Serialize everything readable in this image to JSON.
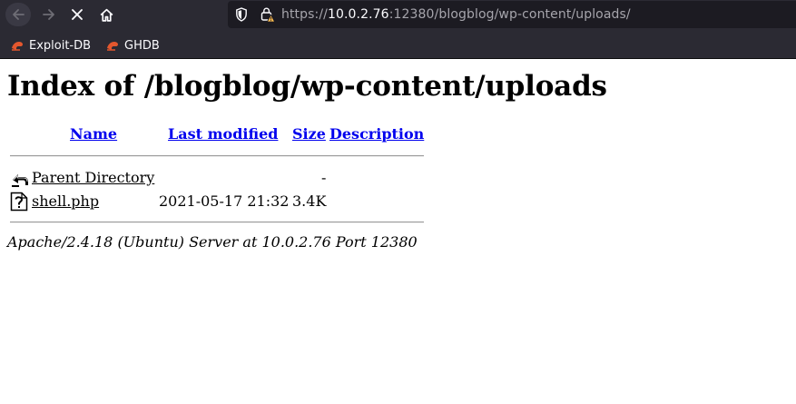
{
  "browser": {
    "url": {
      "scheme": "https://",
      "host": "10.0.2.76",
      "rest": ":12380/blogblog/wp-content/uploads/"
    },
    "bookmarks": [
      {
        "label": "Exploit-DB",
        "icon": "exploit-db-icon"
      },
      {
        "label": "GHDB",
        "icon": "ghdb-icon"
      }
    ]
  },
  "page": {
    "title": "Index of /blogblog/wp-content/uploads",
    "columns": {
      "name": "Name",
      "last_modified": "Last modified",
      "size": "Size",
      "description": "Description"
    },
    "rows": [
      {
        "icon": "back-arrow-icon",
        "name": "Parent Directory",
        "modified": "",
        "size": "-",
        "description": ""
      },
      {
        "icon": "unknown-file-icon",
        "name": "shell.php",
        "modified": "2021-05-17 21:32",
        "size": "3.4K",
        "description": ""
      }
    ],
    "footer": "Apache/2.4.18 (Ubuntu) Server at 10.0.2.76 Port 12380"
  },
  "colors": {
    "chrome_bg": "#2b2a33",
    "urlbar_bg": "#1c1b22",
    "link": "#0000ee"
  }
}
